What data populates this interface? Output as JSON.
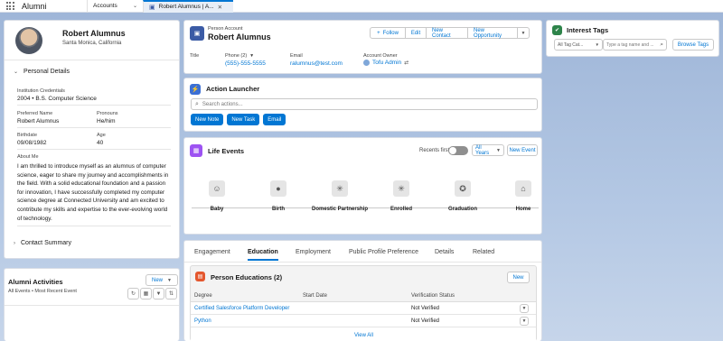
{
  "app": {
    "name": "Alumni"
  },
  "nav": {
    "accounts": "Accounts",
    "active_tab": "Robert Alumnus | A..."
  },
  "profile": {
    "name": "Robert Alumnus",
    "location": "Santa Monica, California"
  },
  "personal": {
    "heading": "Personal Details",
    "credentials_label": "Institution Credentials",
    "credentials_value": "2004 • B.S. Computer Science",
    "preferred_name_label": "Preferred Name",
    "preferred_name_value": "Robert Alumnus",
    "pronouns_label": "Pronouns",
    "pronouns_value": "He/him",
    "birthdate_label": "Birthdate",
    "birthdate_value": "09/08/1982",
    "age_label": "Age",
    "age_value": "40",
    "about_label": "About Me",
    "about_value": "I am thrilled to introduce myself as an alumnus of computer science, eager to share my journey and accomplishments in the field. With a solid educational foundation and a passion for innovation, I have successfully completed my computer science degree at Connected University and am excited to contribute my skills and expertise to the ever-evolving world of technology."
  },
  "contact_summary": {
    "heading": "Contact Summary"
  },
  "activities": {
    "title": "Alumni Activities",
    "filter": "All Events • Most Recent Event",
    "new_label": "New"
  },
  "header": {
    "type": "Person Account",
    "name": "Robert Alumnus",
    "follow": "Follow",
    "edit": "Edit",
    "new_contact": "New Contact",
    "new_opportunity": "New Opportunity",
    "title_label": "Title",
    "phone_label": "Phone (2)",
    "phone_value": "(555)-555-5555",
    "email_label": "Email",
    "email_value": "ralumnus@test.com",
    "owner_label": "Account Owner",
    "owner_value": "Tofu Admin"
  },
  "action_launcher": {
    "title": "Action Launcher",
    "search_placeholder": "Search actions...",
    "buttons": [
      "New Note",
      "New Task",
      "Email"
    ]
  },
  "life_events": {
    "title": "Life Events",
    "recents_first": "Recents first",
    "years": "All Years",
    "new_event": "New Event",
    "events": [
      {
        "label": "Baby",
        "icon": "smiley-icon"
      },
      {
        "label": "Birth",
        "icon": "person-icon"
      },
      {
        "label": "Domestic Partnership",
        "icon": "asterisk-icon"
      },
      {
        "label": "Enrolled",
        "icon": "asterisk-icon"
      },
      {
        "label": "Graduation",
        "icon": "ribbon-icon"
      },
      {
        "label": "Home",
        "icon": "home-icon"
      }
    ]
  },
  "tabs": [
    "Engagement",
    "Education",
    "Employment",
    "Public Profile Preference",
    "Details",
    "Related"
  ],
  "active_tab": "Education",
  "educations": {
    "title": "Person Educations (2)",
    "new_label": "New",
    "columns": [
      "Degree",
      "Start Date",
      "Verification Status"
    ],
    "rows": [
      {
        "degree": "Certified Salesforce Platform Developer",
        "start": "",
        "status": "Not Verified"
      },
      {
        "degree": "Python",
        "start": "",
        "status": "Not Verified"
      }
    ],
    "view_all": "View All"
  },
  "interest_tags": {
    "title": "Interest Tags",
    "category_placeholder": "All Tag Cat...",
    "search_placeholder": "Type a tag name and ...",
    "browse": "Browse Tags"
  },
  "colors": {
    "brand": "#0176d3",
    "tags_icon": "#2e844a",
    "action_icon": "#3b6fd4",
    "life_icon": "#9d53f2",
    "edu_icon": "#e4572e",
    "header_icon": "#3b5ba5"
  }
}
